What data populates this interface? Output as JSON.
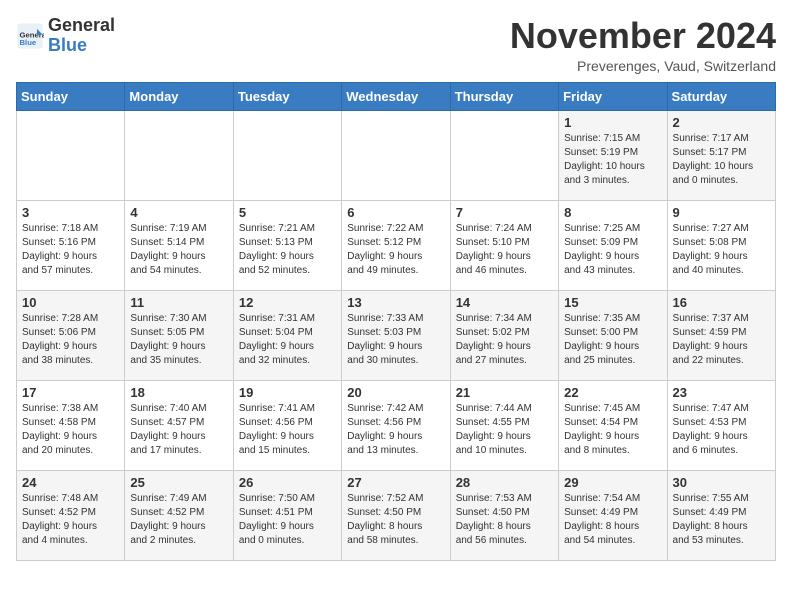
{
  "header": {
    "logo_line1": "General",
    "logo_line2": "Blue",
    "month": "November 2024",
    "location": "Preverenges, Vaud, Switzerland"
  },
  "weekdays": [
    "Sunday",
    "Monday",
    "Tuesday",
    "Wednesday",
    "Thursday",
    "Friday",
    "Saturday"
  ],
  "weeks": [
    [
      {
        "day": "",
        "info": ""
      },
      {
        "day": "",
        "info": ""
      },
      {
        "day": "",
        "info": ""
      },
      {
        "day": "",
        "info": ""
      },
      {
        "day": "",
        "info": ""
      },
      {
        "day": "1",
        "info": "Sunrise: 7:15 AM\nSunset: 5:19 PM\nDaylight: 10 hours\nand 3 minutes."
      },
      {
        "day": "2",
        "info": "Sunrise: 7:17 AM\nSunset: 5:17 PM\nDaylight: 10 hours\nand 0 minutes."
      }
    ],
    [
      {
        "day": "3",
        "info": "Sunrise: 7:18 AM\nSunset: 5:16 PM\nDaylight: 9 hours\nand 57 minutes."
      },
      {
        "day": "4",
        "info": "Sunrise: 7:19 AM\nSunset: 5:14 PM\nDaylight: 9 hours\nand 54 minutes."
      },
      {
        "day": "5",
        "info": "Sunrise: 7:21 AM\nSunset: 5:13 PM\nDaylight: 9 hours\nand 52 minutes."
      },
      {
        "day": "6",
        "info": "Sunrise: 7:22 AM\nSunset: 5:12 PM\nDaylight: 9 hours\nand 49 minutes."
      },
      {
        "day": "7",
        "info": "Sunrise: 7:24 AM\nSunset: 5:10 PM\nDaylight: 9 hours\nand 46 minutes."
      },
      {
        "day": "8",
        "info": "Sunrise: 7:25 AM\nSunset: 5:09 PM\nDaylight: 9 hours\nand 43 minutes."
      },
      {
        "day": "9",
        "info": "Sunrise: 7:27 AM\nSunset: 5:08 PM\nDaylight: 9 hours\nand 40 minutes."
      }
    ],
    [
      {
        "day": "10",
        "info": "Sunrise: 7:28 AM\nSunset: 5:06 PM\nDaylight: 9 hours\nand 38 minutes."
      },
      {
        "day": "11",
        "info": "Sunrise: 7:30 AM\nSunset: 5:05 PM\nDaylight: 9 hours\nand 35 minutes."
      },
      {
        "day": "12",
        "info": "Sunrise: 7:31 AM\nSunset: 5:04 PM\nDaylight: 9 hours\nand 32 minutes."
      },
      {
        "day": "13",
        "info": "Sunrise: 7:33 AM\nSunset: 5:03 PM\nDaylight: 9 hours\nand 30 minutes."
      },
      {
        "day": "14",
        "info": "Sunrise: 7:34 AM\nSunset: 5:02 PM\nDaylight: 9 hours\nand 27 minutes."
      },
      {
        "day": "15",
        "info": "Sunrise: 7:35 AM\nSunset: 5:00 PM\nDaylight: 9 hours\nand 25 minutes."
      },
      {
        "day": "16",
        "info": "Sunrise: 7:37 AM\nSunset: 4:59 PM\nDaylight: 9 hours\nand 22 minutes."
      }
    ],
    [
      {
        "day": "17",
        "info": "Sunrise: 7:38 AM\nSunset: 4:58 PM\nDaylight: 9 hours\nand 20 minutes."
      },
      {
        "day": "18",
        "info": "Sunrise: 7:40 AM\nSunset: 4:57 PM\nDaylight: 9 hours\nand 17 minutes."
      },
      {
        "day": "19",
        "info": "Sunrise: 7:41 AM\nSunset: 4:56 PM\nDaylight: 9 hours\nand 15 minutes."
      },
      {
        "day": "20",
        "info": "Sunrise: 7:42 AM\nSunset: 4:56 PM\nDaylight: 9 hours\nand 13 minutes."
      },
      {
        "day": "21",
        "info": "Sunrise: 7:44 AM\nSunset: 4:55 PM\nDaylight: 9 hours\nand 10 minutes."
      },
      {
        "day": "22",
        "info": "Sunrise: 7:45 AM\nSunset: 4:54 PM\nDaylight: 9 hours\nand 8 minutes."
      },
      {
        "day": "23",
        "info": "Sunrise: 7:47 AM\nSunset: 4:53 PM\nDaylight: 9 hours\nand 6 minutes."
      }
    ],
    [
      {
        "day": "24",
        "info": "Sunrise: 7:48 AM\nSunset: 4:52 PM\nDaylight: 9 hours\nand 4 minutes."
      },
      {
        "day": "25",
        "info": "Sunrise: 7:49 AM\nSunset: 4:52 PM\nDaylight: 9 hours\nand 2 minutes."
      },
      {
        "day": "26",
        "info": "Sunrise: 7:50 AM\nSunset: 4:51 PM\nDaylight: 9 hours\nand 0 minutes."
      },
      {
        "day": "27",
        "info": "Sunrise: 7:52 AM\nSunset: 4:50 PM\nDaylight: 8 hours\nand 58 minutes."
      },
      {
        "day": "28",
        "info": "Sunrise: 7:53 AM\nSunset: 4:50 PM\nDaylight: 8 hours\nand 56 minutes."
      },
      {
        "day": "29",
        "info": "Sunrise: 7:54 AM\nSunset: 4:49 PM\nDaylight: 8 hours\nand 54 minutes."
      },
      {
        "day": "30",
        "info": "Sunrise: 7:55 AM\nSunset: 4:49 PM\nDaylight: 8 hours\nand 53 minutes."
      }
    ]
  ]
}
